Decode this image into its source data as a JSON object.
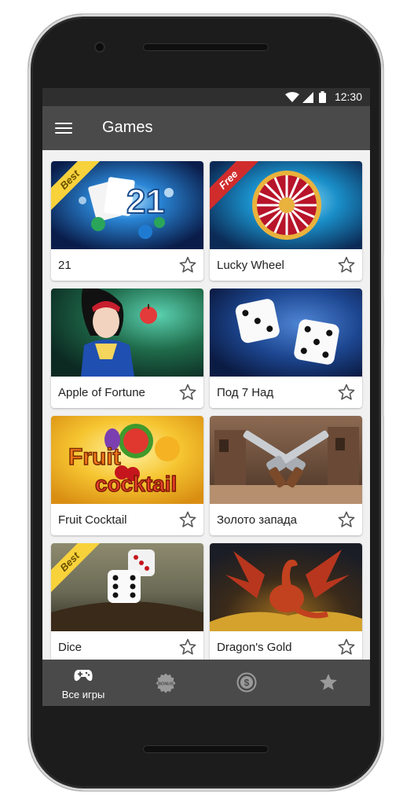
{
  "statusbar": {
    "time": "12:30"
  },
  "appbar": {
    "title": "Games",
    "menu_icon": "hamburger-menu-icon"
  },
  "games": [
    {
      "title": "21",
      "badge": "Best",
      "badge_color": "#f7d23b"
    },
    {
      "title": "Lucky Wheel",
      "badge": "Free",
      "badge_color": "#d12c2c"
    },
    {
      "title": "Apple of Fortune",
      "badge": ""
    },
    {
      "title": "Под 7 Над",
      "badge": ""
    },
    {
      "title": "Fruit Cocktail",
      "badge": "",
      "art_text_1": "Fruit",
      "art_text_2": "cocktail"
    },
    {
      "title": "Золото запада",
      "badge": ""
    },
    {
      "title": "Dice",
      "badge": "Best",
      "badge_color": "#f7d23b"
    },
    {
      "title": "Dragon's Gold",
      "badge": ""
    }
  ],
  "bottom_nav": {
    "items": [
      {
        "label": "Все игры",
        "icon": "gamepad-icon",
        "active": true
      },
      {
        "label": "",
        "icon": "bonus-icon",
        "icon_text": "BONUS"
      },
      {
        "label": "",
        "icon": "dollar-coin-icon"
      },
      {
        "label": "",
        "icon": "star-icon"
      }
    ]
  },
  "colors": {
    "appbar": "#4a4a4a",
    "statusbar": "#2f2f2f",
    "background": "#f1f1f1"
  }
}
